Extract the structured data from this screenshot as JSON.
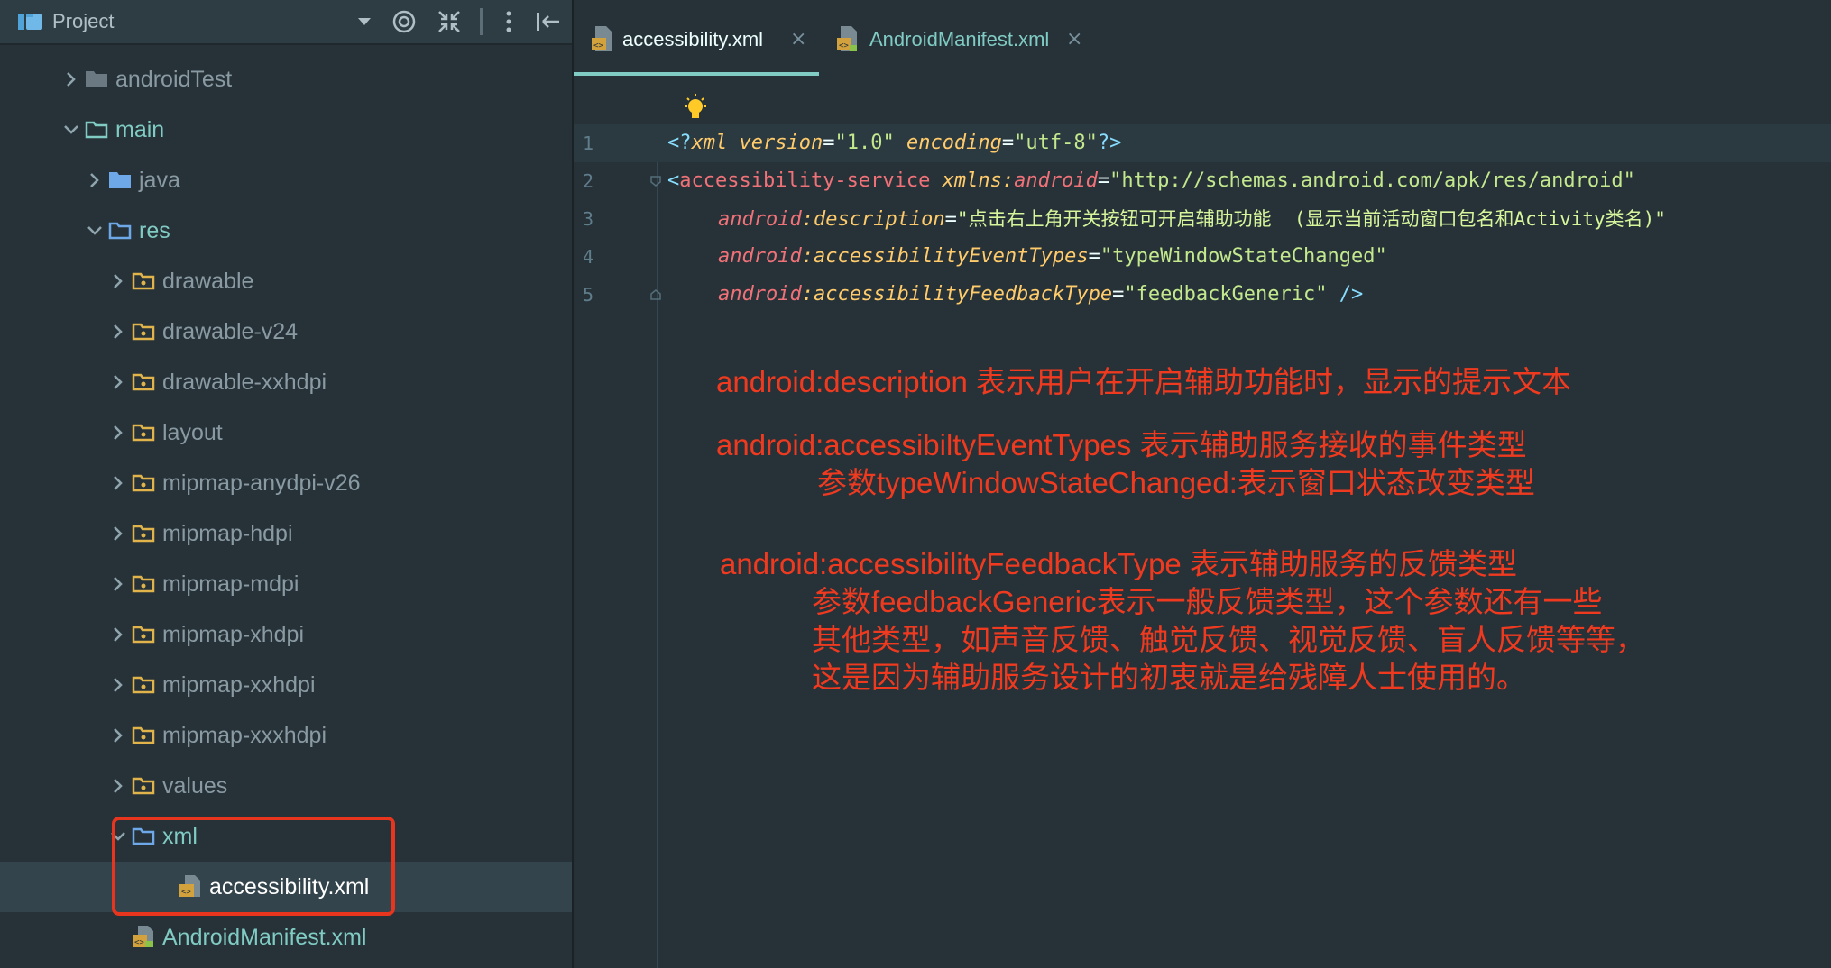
{
  "sidebar": {
    "title": "Project",
    "tree": [
      {
        "label": "androidTest",
        "expanded": false,
        "icon": "folder-gray-icon"
      },
      {
        "label": "main",
        "expanded": true,
        "icon": "folder-teal-outline-icon"
      },
      {
        "label": "java",
        "expanded": false,
        "icon": "folder-blue-icon"
      },
      {
        "label": "res",
        "expanded": true,
        "icon": "folder-res-icon"
      },
      {
        "label": "drawable",
        "expanded": false,
        "icon": "folder-yellow-icon"
      },
      {
        "label": "drawable-v24",
        "expanded": false,
        "icon": "folder-yellow-icon"
      },
      {
        "label": "drawable-xxhdpi",
        "expanded": false,
        "icon": "folder-yellow-icon"
      },
      {
        "label": "layout",
        "expanded": false,
        "icon": "folder-yellow-icon"
      },
      {
        "label": "mipmap-anydpi-v26",
        "expanded": false,
        "icon": "folder-yellow-icon"
      },
      {
        "label": "mipmap-hdpi",
        "expanded": false,
        "icon": "folder-yellow-icon"
      },
      {
        "label": "mipmap-mdpi",
        "expanded": false,
        "icon": "folder-yellow-icon"
      },
      {
        "label": "mipmap-xhdpi",
        "expanded": false,
        "icon": "folder-yellow-icon"
      },
      {
        "label": "mipmap-xxhdpi",
        "expanded": false,
        "icon": "folder-yellow-icon"
      },
      {
        "label": "mipmap-xxxhdpi",
        "expanded": false,
        "icon": "folder-yellow-icon"
      },
      {
        "label": "values",
        "expanded": false,
        "icon": "folder-yellow-icon"
      },
      {
        "label": "xml",
        "expanded": true,
        "icon": "folder-blue-outline-icon"
      },
      {
        "label": "accessibility.xml",
        "icon": "xml-file-icon",
        "selected": true
      },
      {
        "label": "AndroidManifest.xml",
        "icon": "manifest-file-icon"
      }
    ]
  },
  "editor": {
    "tabs": [
      {
        "label": "accessibility.xml",
        "active": true,
        "close": "×"
      },
      {
        "label": "AndroidManifest.xml",
        "active": false,
        "close": "×"
      }
    ],
    "line_numbers": [
      "1",
      "2",
      "3",
      "4",
      "5"
    ],
    "code": {
      "l1_open": "<?",
      "l1_xml": "xml",
      "l1_version_attr": "version",
      "l1_eq": "=",
      "l1_version_val": "\"1.0\"",
      "l1_encoding_attr": "encoding",
      "l1_encoding_val": "\"utf-8\"",
      "l1_close": "?>",
      "l2_lt": "<",
      "l2_tag": "accessibility-service",
      "l2_xmlns": "xmlns:",
      "l2_android": "android",
      "l2_val": "\"http://schemas.android.com/apk/res/android\"",
      "ns": "android",
      "colon": ":",
      "l3_attr": "description",
      "l3_val": "\"点击右上角开关按钮可开启辅助功能  (显示当前活动窗口包名和Activity类名)\"",
      "l4_attr": "accessibilityEventTypes",
      "l4_val": "\"typeWindowStateChanged\"",
      "l5_attr": "accessibilityFeedbackType",
      "l5_val": "\"feedbackGeneric\"",
      "l5_close": "/>"
    },
    "annotations": {
      "a1": "android:description 表示用户在开启辅助功能时，显示的提示文本",
      "a2": "android:accessibiltyEventTypes 表示辅助服务接收的事件类型",
      "a3": "参数typeWindowStateChanged:表示窗口状态改变类型",
      "a4": "android:accessibilityFeedbackType 表示辅助服务的反馈类型",
      "a5": "参数feedbackGeneric表示一般反馈类型，这个参数还有一些",
      "a6": "其他类型，如声音反馈、触觉反馈、视觉反馈、盲人反馈等等，",
      "a7": "这是因为辅助服务设计的初衷就是给残障人士使用的。"
    }
  },
  "colors": {
    "background": "#263238",
    "annotation_red": "#f03a20",
    "accent": "#80cbc4"
  }
}
